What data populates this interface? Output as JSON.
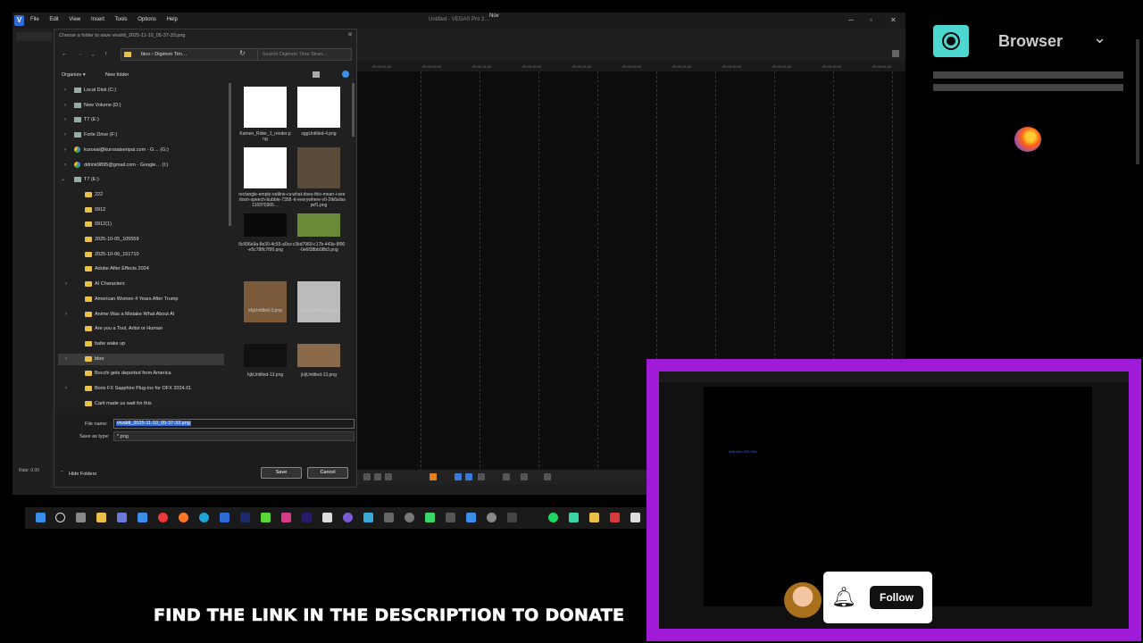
{
  "vegas": {
    "title": "Untitled - VEGAS Pro 2…",
    "menu": [
      "File",
      "Edit",
      "View",
      "Insert",
      "Tools",
      "Options",
      "Help"
    ],
    "rate_label": "Rate: 0.00",
    "ruler_ticks": [
      "00:00:04:29",
      "00:00:09:29",
      "00:00:14:29",
      "00:00:19:29",
      "00:00:24:29",
      "00:00:29:29",
      "00:00:34:29",
      "00:00:39:29",
      "00:00:44:29",
      "00:00:49:29",
      "00:00:54:29"
    ],
    "tooltip": "Nov"
  },
  "dialog": {
    "title": "Choose a folder to save vivaldi_2025-11-10_05-37-33.png",
    "address": "bloo  ›  Digimon Tim…",
    "search_placeholder": "Search Digimon Time Stran…",
    "organize": "Organize ▾",
    "new_folder": "New folder",
    "tree": [
      {
        "label": "Local Disk (C:)",
        "kind": "drive",
        "indent": 0
      },
      {
        "label": "New Volume (D:)",
        "kind": "drive",
        "indent": 0
      },
      {
        "label": "T7 (E:)",
        "kind": "drive",
        "indent": 0
      },
      {
        "label": "Forte Drive (F:)",
        "kind": "drive",
        "indent": 0
      },
      {
        "label": "kurosai@kurosaisenpai.com - G… (G:)",
        "kind": "gdrive",
        "indent": 0
      },
      {
        "label": "ddrink9895@gmail.com - Google… (I:)",
        "kind": "gdrive",
        "indent": 0
      },
      {
        "label": "T7 (E:)",
        "kind": "drive-open",
        "indent": 0
      },
      {
        "label": "222",
        "kind": "folder",
        "indent": 1
      },
      {
        "label": "0912",
        "kind": "folder",
        "indent": 1
      },
      {
        "label": "0912(1)",
        "kind": "folder",
        "indent": 1
      },
      {
        "label": "2025-10-05_105559",
        "kind": "folder",
        "indent": 1
      },
      {
        "label": "2025-10-06_151710",
        "kind": "folder",
        "indent": 1
      },
      {
        "label": "Adobe After Effects 2024",
        "kind": "folder",
        "indent": 1
      },
      {
        "label": "AI Characters",
        "kind": "folder-exp",
        "indent": 1
      },
      {
        "label": "American Women 4 Years After Trump",
        "kind": "folder",
        "indent": 1
      },
      {
        "label": "Anime Was a Mistake What About AI",
        "kind": "folder-exp",
        "indent": 1
      },
      {
        "label": "Are you a Tool, Artist or Human",
        "kind": "folder",
        "indent": 1
      },
      {
        "label": "babe wake up",
        "kind": "folder",
        "indent": 1
      },
      {
        "label": "bloo",
        "kind": "folder-exp",
        "indent": 1
      },
      {
        "label": "Bocchi gets deported from America",
        "kind": "folder",
        "indent": 1
      },
      {
        "label": "Boris FX Sapphire Plug-ins for OFX 2024.01",
        "kind": "folder-exp",
        "indent": 1
      },
      {
        "label": "Carti made us wait for this",
        "kind": "folder",
        "indent": 1
      }
    ],
    "files": [
      {
        "name": "Kamen_Rider_1_render.png",
        "color": "#ffffff"
      },
      {
        "name": "sggUntitled-4.png",
        "color": "#ffffff"
      },
      {
        "name": "rectangle-empty-outline-cartoon-speech-bubble-7358116970365…",
        "color": "#ffffff"
      },
      {
        "name": "what-does-this-mean-i-see-it-everywhere-v0-2tk6silssjwf1.png",
        "color": "#5a4a3a"
      },
      {
        "name": "8c996e9a-8e30-4c55-a0ce-e5c78ffc7f90.png",
        "color": "#0a0a0a"
      },
      {
        "name": "c3bd7969-c17b-443e-8f90-0e6f38bb08b3.png",
        "color": "#6a8a3a"
      },
      {
        "name": "sfgUntitled-3.png",
        "color": "#7a5a3a"
      },
      {
        "name": "1651Untitled-2.png",
        "color": "#bbbbbb"
      },
      {
        "name": "hjkUntitled-13.png",
        "color": "#111111"
      },
      {
        "name": "jkljUntitled-13.png",
        "color": "#8a6a4a"
      }
    ],
    "file_name_label": "File name:",
    "file_name_value": "vivaldi_2025-11-10_05-37-33.png",
    "save_type_label": "Save as type:",
    "save_type_value": "*.png",
    "hide_folders": "Hide Folders",
    "save": "Save",
    "cancel": "Cancel"
  },
  "right_panel": {
    "label": "Browser",
    "accent": "#4dd8cf"
  },
  "cam": {
    "border_color": "#a01bd8",
    "inner_label": "Add Abv. DFU tAv"
  },
  "follow": {
    "label": "Follow"
  },
  "banner": "FIND THE LINK IN THE DESCRIPTION TO DONATE"
}
